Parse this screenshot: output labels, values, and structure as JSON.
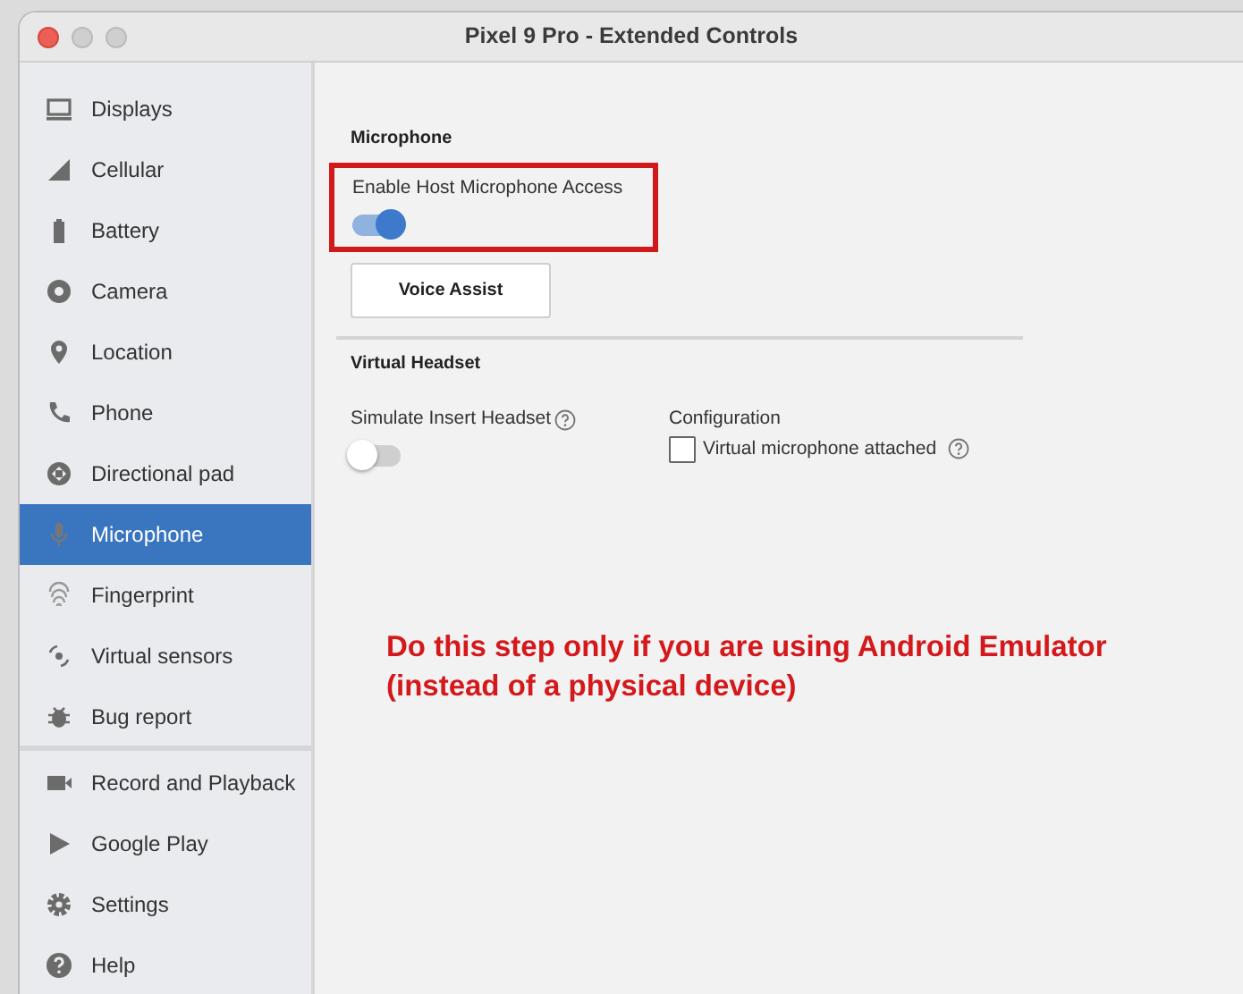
{
  "window": {
    "title": "Pixel 9 Pro - Extended Controls"
  },
  "sidebar": {
    "groups": [
      {
        "items": [
          {
            "label": "Displays",
            "selected": false
          },
          {
            "label": "Cellular",
            "selected": false
          },
          {
            "label": "Battery",
            "selected": false
          },
          {
            "label": "Camera",
            "selected": false
          },
          {
            "label": "Location",
            "selected": false
          },
          {
            "label": "Phone",
            "selected": false
          },
          {
            "label": "Directional pad",
            "selected": false
          },
          {
            "label": "Microphone",
            "selected": true
          },
          {
            "label": "Fingerprint",
            "selected": false
          },
          {
            "label": "Virtual sensors",
            "selected": false
          },
          {
            "label": "Bug report",
            "selected": false
          }
        ]
      },
      {
        "items": [
          {
            "label": "Record and Playback",
            "selected": false
          },
          {
            "label": "Google Play",
            "selected": false
          },
          {
            "label": "Settings",
            "selected": false
          },
          {
            "label": "Help",
            "selected": false
          }
        ]
      }
    ]
  },
  "microphone": {
    "heading": "Microphone",
    "host_access": {
      "label": "Enable Host Microphone Access",
      "on": true
    },
    "voice_assist_button": "Voice Assist"
  },
  "virtual_headset": {
    "heading": "Virtual Headset",
    "simulate": {
      "label": "Simulate Insert Headset",
      "on": false
    },
    "configuration": {
      "label": "Configuration",
      "checkbox": {
        "label": "Virtual microphone attached",
        "checked": false
      }
    }
  },
  "annotation": {
    "lines": [
      "Do this step only if you are using Android Emulator",
      "(instead of a physical device)"
    ]
  }
}
